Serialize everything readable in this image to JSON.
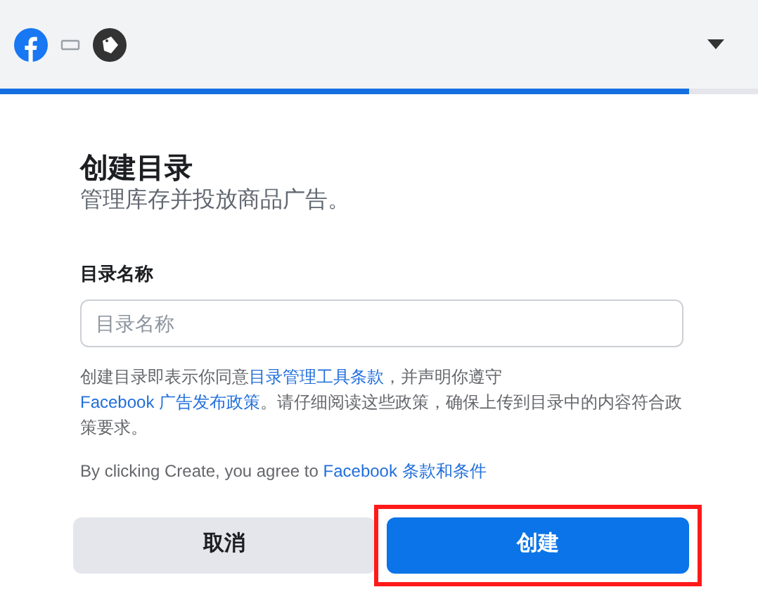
{
  "header": {
    "progress": {
      "level": 0.91
    }
  },
  "title": "创建目录",
  "subtitle": "管理库存并投放商品广告。",
  "field": {
    "label": "目录名称",
    "placeholder": "目录名称"
  },
  "policy": [
    {
      "kind": "text",
      "text": "创建目录即表示你同意"
    },
    {
      "kind": "link",
      "text": "目录管理工具条款"
    },
    {
      "kind": "text",
      "text": "，并声明你遵守"
    },
    {
      "kind": "link",
      "text": "Facebook 广告发布政策"
    },
    {
      "kind": "text",
      "text": "。请仔细阅读这些政策，确保上传到目录中的内容符合政策要求。"
    }
  ],
  "agreement": [
    {
      "kind": "text",
      "text": "By clicking Create, you agree to "
    },
    {
      "kind": "link",
      "text": "Facebook 条款和条件"
    }
  ],
  "buttons": [
    {
      "label": "取消",
      "kind": "secondary",
      "highlighted": false
    },
    {
      "label": "创建",
      "kind": "primary",
      "highlighted": true
    }
  ]
}
